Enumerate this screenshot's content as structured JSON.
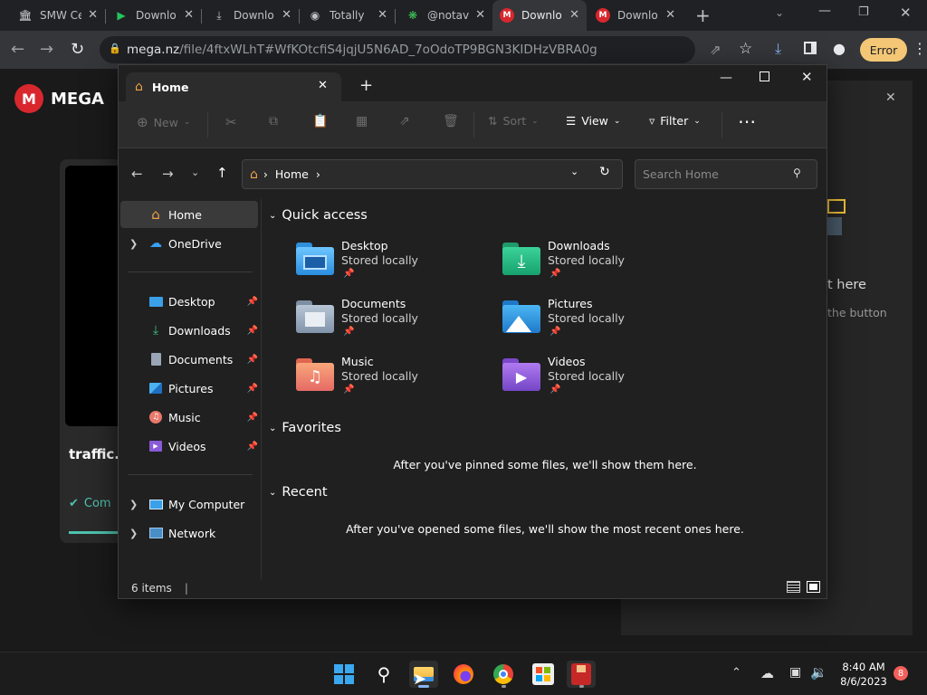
{
  "browser": {
    "tabs": [
      {
        "title": "SMW Ce",
        "icon": "museum-icon"
      },
      {
        "title": "Downlo",
        "icon": "green-arrow-icon"
      },
      {
        "title": "Downlo",
        "icon": "download-icon"
      },
      {
        "title": "Totally",
        "icon": "circle-icon"
      },
      {
        "title": "@notav",
        "icon": "green-asterisk-icon"
      },
      {
        "title": "Downlo",
        "icon": "mega-icon"
      },
      {
        "title": "Downlo",
        "icon": "mega-icon"
      }
    ],
    "active_tab_index": 5,
    "url_domain": "mega.nz",
    "url_path": "/file/4ftxWLhT#WfKOtcfiS4jqjU5N6AD_7oOdoTP9BGN3KIDHzVBRA0g",
    "error_label": "Error"
  },
  "mega": {
    "logo_text": "MEGA",
    "file_name": "traffic.b",
    "status_text": "Com",
    "right_panel_line1": "t here",
    "right_panel_line2": "the button"
  },
  "explorer": {
    "tab_title": "Home",
    "toolbar": {
      "new": "New",
      "sort": "Sort",
      "view": "View",
      "filter": "Filter"
    },
    "breadcrumb": "Home",
    "search_placeholder": "Search Home",
    "nav": {
      "home": "Home",
      "onedrive": "OneDrive",
      "pinned": [
        {
          "label": "Desktop",
          "icon": "desktop-icon"
        },
        {
          "label": "Downloads",
          "icon": "downloads-icon"
        },
        {
          "label": "Documents",
          "icon": "documents-icon"
        },
        {
          "label": "Pictures",
          "icon": "pictures-icon"
        },
        {
          "label": "Music",
          "icon": "music-icon"
        },
        {
          "label": "Videos",
          "icon": "videos-icon"
        }
      ],
      "my_computer": "My Computer",
      "network": "Network"
    },
    "quick_access_title": "Quick access",
    "quick_access": [
      {
        "name": "Desktop",
        "sub": "Stored locally",
        "icon": "desktop-folder-icon"
      },
      {
        "name": "Downloads",
        "sub": "Stored locally",
        "icon": "downloads-folder-icon"
      },
      {
        "name": "Documents",
        "sub": "Stored locally",
        "icon": "documents-folder-icon"
      },
      {
        "name": "Pictures",
        "sub": "Stored locally",
        "icon": "pictures-folder-icon"
      },
      {
        "name": "Music",
        "sub": "Stored locally",
        "icon": "music-folder-icon"
      },
      {
        "name": "Videos",
        "sub": "Stored locally",
        "icon": "videos-folder-icon"
      }
    ],
    "favorites_title": "Favorites",
    "favorites_empty": "After you've pinned some files, we'll show them here.",
    "recent_title": "Recent",
    "recent_empty": "After you've opened some files, we'll show the most recent ones here.",
    "status": "6 items"
  },
  "taskbar": {
    "time": "8:40 AM",
    "date": "8/6/2023",
    "notifications": "8"
  }
}
